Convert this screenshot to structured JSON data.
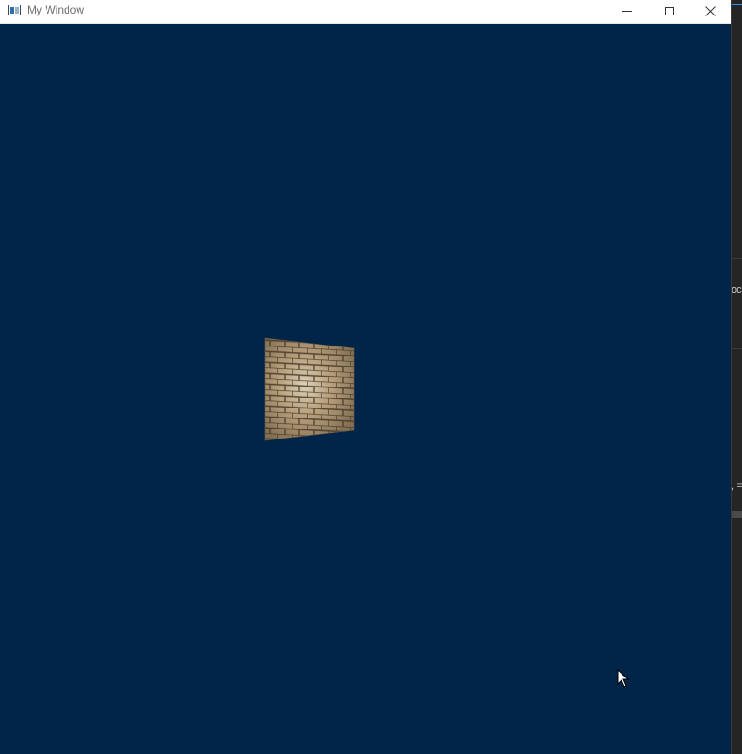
{
  "window": {
    "title": "My Window",
    "background_color": "#012549",
    "caption_buttons": {
      "minimize": "minimize-icon",
      "maximize": "maximize-icon",
      "close": "close-icon"
    }
  },
  "scene": {
    "object": "textured-quad",
    "texture": "brick-wall"
  },
  "background_app": {
    "fragments": [
      "oc",
      ", ="
    ]
  }
}
